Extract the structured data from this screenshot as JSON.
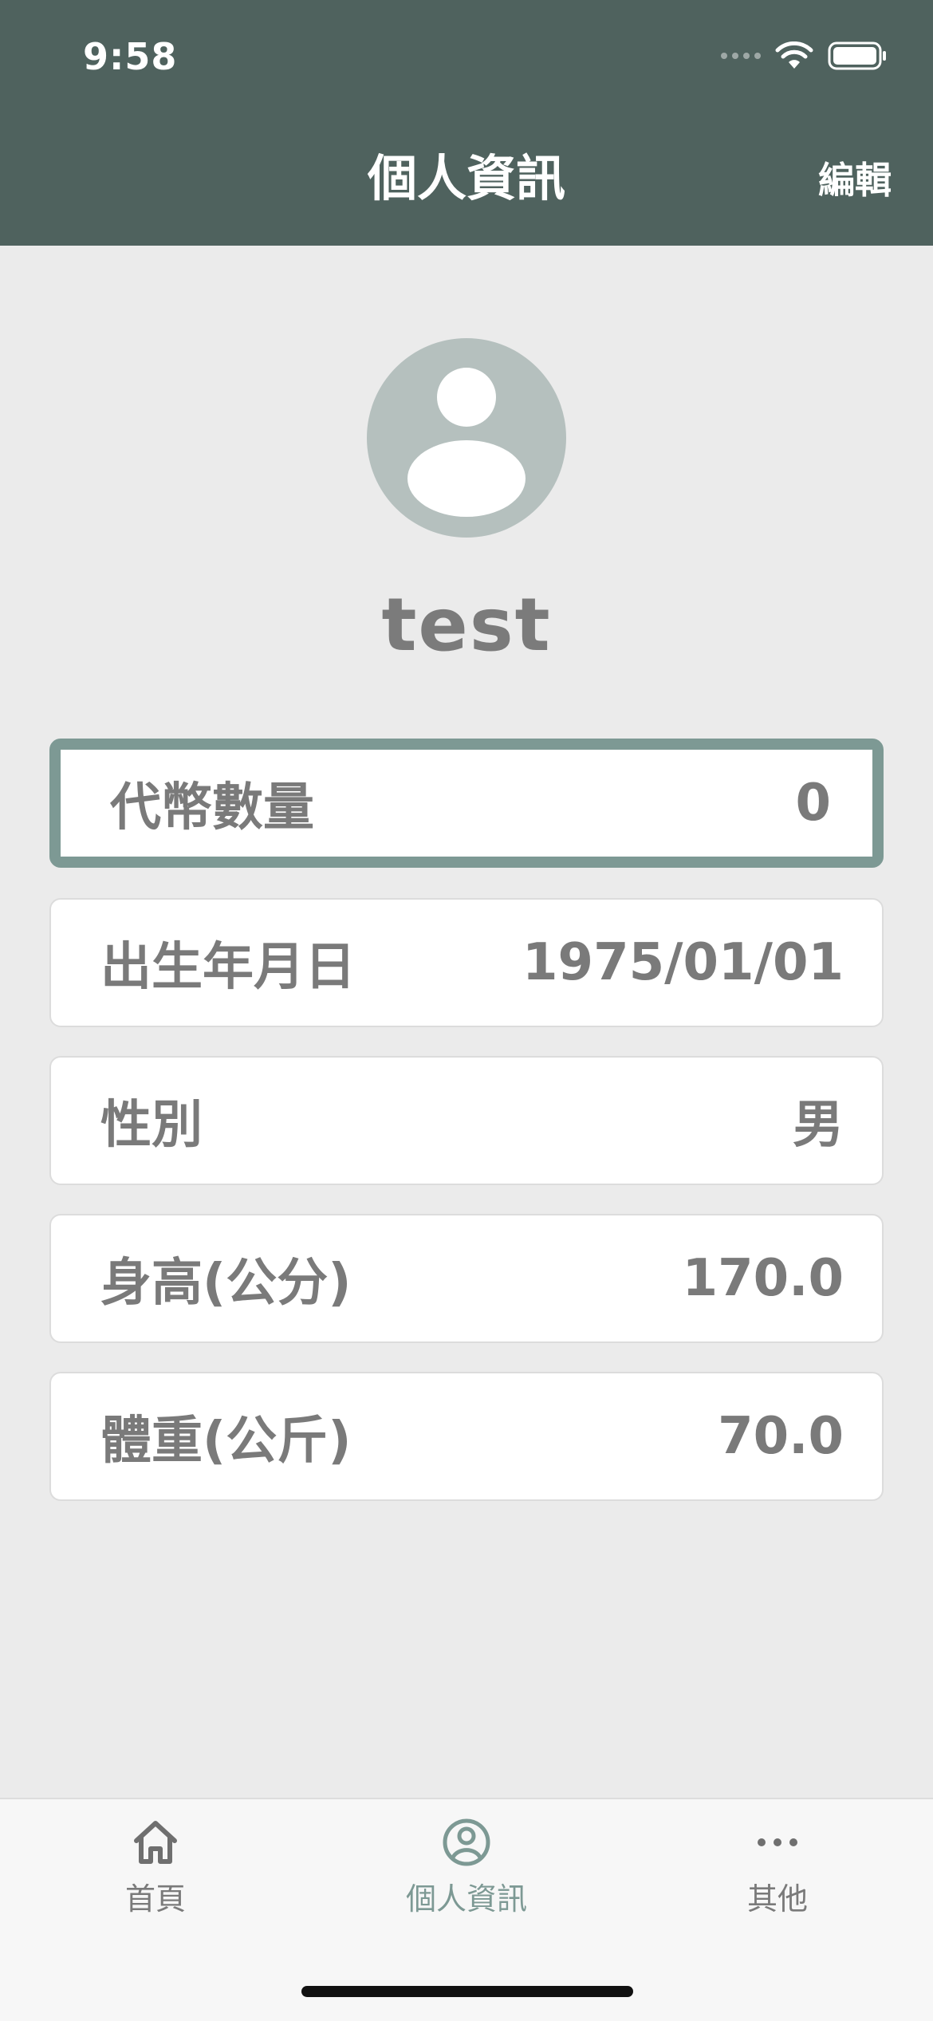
{
  "status_bar": {
    "time": "9:58"
  },
  "header": {
    "title": "個人資訊",
    "edit_label": "編輯"
  },
  "profile": {
    "username": "test"
  },
  "info_rows": [
    {
      "label": "代幣數量",
      "value": "0"
    },
    {
      "label": "出生年月日",
      "value": "1975/01/01"
    },
    {
      "label": "性別",
      "value": "男"
    },
    {
      "label": "身高(公分)",
      "value": "170.0"
    },
    {
      "label": "體重(公斤)",
      "value": "70.0"
    }
  ],
  "tab_bar": {
    "items": [
      {
        "label": "首頁",
        "icon": "home-icon"
      },
      {
        "label": "個人資訊",
        "icon": "profile-icon",
        "active": true
      },
      {
        "label": "其他",
        "icon": "more-icon"
      }
    ]
  },
  "colors": {
    "header_bg": "#4f625e",
    "accent": "#7d9994",
    "background": "#ebebeb"
  }
}
